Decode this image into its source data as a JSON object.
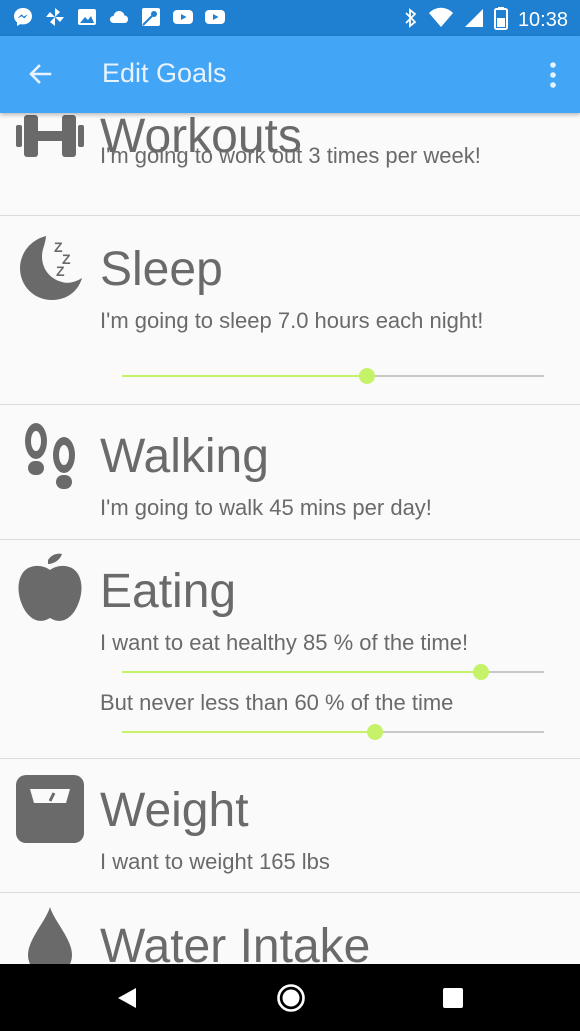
{
  "status_bar": {
    "time": "10:38",
    "left_icons": [
      "messenger-icon",
      "pinwheel-icon",
      "photos-icon",
      "cloud-icon",
      "maps-icon",
      "youtube-icon",
      "youtube-icon"
    ],
    "right_icons": [
      "bluetooth-icon",
      "wifi-icon",
      "signal-icon",
      "battery-icon"
    ]
  },
  "app_bar": {
    "title": "Edit Goals",
    "back_icon": "arrow-back-icon",
    "menu_icon": "more-vert-icon"
  },
  "colors": {
    "status_bar": "#1f7fd0",
    "app_bar": "#42a5f5",
    "slider_accent": "#c6f26a",
    "icon_gray": "#6a6a6a"
  },
  "goals": {
    "workouts": {
      "title": "Workouts",
      "description": "I'm going to work out 3 times per week!",
      "icon": "dumbbell-icon"
    },
    "sleep": {
      "title": "Sleep",
      "description": "I'm going to sleep 7.0 hours each night!",
      "icon": "moon-sleep-icon",
      "slider_fraction": 0.58
    },
    "walking": {
      "title": "Walking",
      "description": "I'm going to walk 45 mins per day!",
      "icon": "footprints-icon"
    },
    "eating": {
      "title": "Eating",
      "description": "I want to eat healthy 85 % of the time!",
      "slider_fraction": 0.85,
      "min_description": "But never less than 60 % of the time",
      "min_slider_fraction": 0.6,
      "icon": "apple-icon"
    },
    "weight": {
      "title": "Weight",
      "description": "I want to weight 165 lbs",
      "icon": "scale-icon"
    },
    "water": {
      "title": "Water Intake",
      "icon": "water-drop-icon"
    }
  },
  "nav_bar": {
    "icons": [
      "nav-back-icon",
      "nav-home-icon",
      "nav-recents-icon"
    ]
  }
}
